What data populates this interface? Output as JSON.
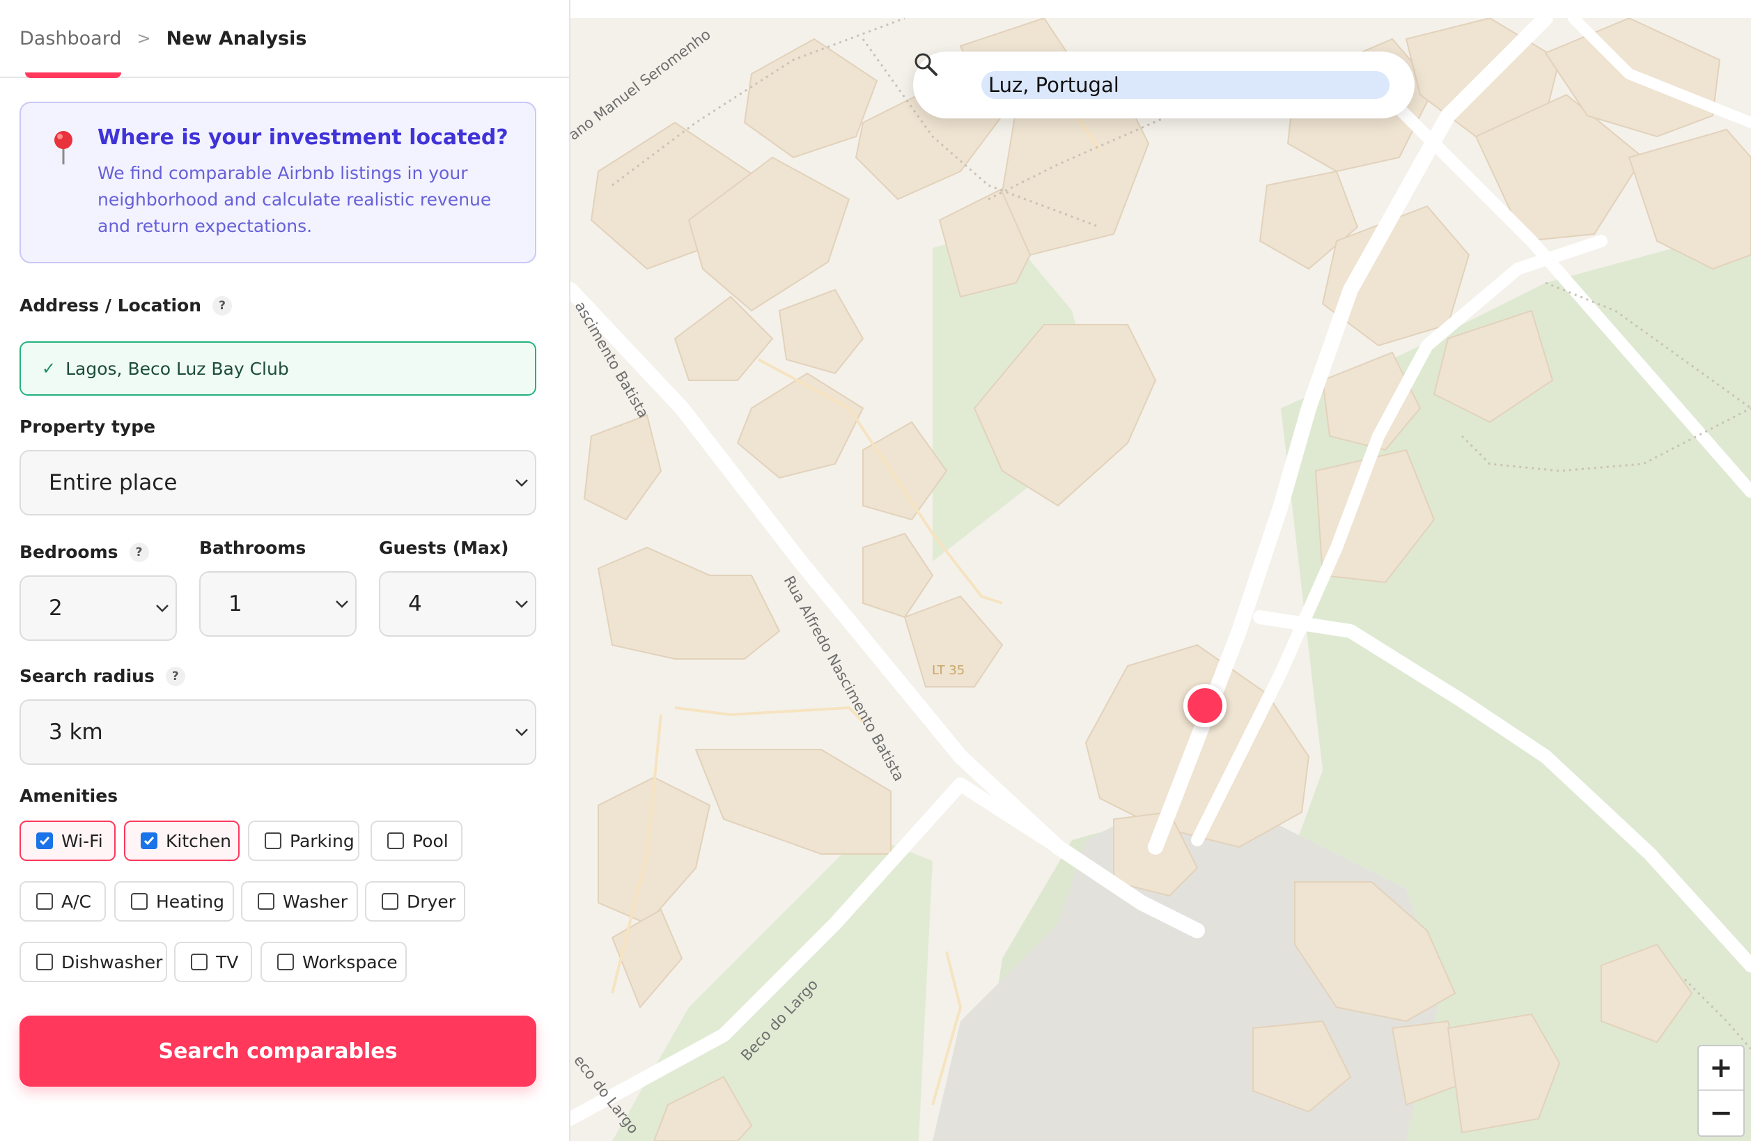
{
  "breadcrumb": {
    "parent": "Dashboard",
    "separator": ">",
    "current": "New Analysis"
  },
  "info": {
    "title": "Where is your investment located?",
    "text": "We find comparable Airbnb listings in your neighborhood and calculate realistic revenue and return expectations.",
    "icon": "map-pin-icon"
  },
  "form": {
    "address_label": "Address / Location",
    "address_value": "Lagos, Beco Luz Bay Club",
    "address_check": "✓",
    "property_type_label": "Property type",
    "property_type_value": "Entire place",
    "bedrooms_label": "Bedrooms",
    "bedrooms_value": "2",
    "bathrooms_label": "Bathrooms",
    "bathrooms_value": "1",
    "guests_label": "Guests (Max)",
    "guests_value": "4",
    "radius_label": "Search radius",
    "radius_value": "3 km",
    "amenities_label": "Amenities",
    "help": "?"
  },
  "amenities": [
    {
      "label": "Wi-Fi",
      "checked": true
    },
    {
      "label": "Kitchen",
      "checked": true
    },
    {
      "label": "Parking",
      "checked": false
    },
    {
      "label": "Pool",
      "checked": false
    },
    {
      "label": "A/C",
      "checked": false
    },
    {
      "label": "Heating",
      "checked": false
    },
    {
      "label": "Washer",
      "checked": false
    },
    {
      "label": "Dryer",
      "checked": false
    },
    {
      "label": "Dishwasher",
      "checked": false
    },
    {
      "label": "TV",
      "checked": false
    },
    {
      "label": "Workspace",
      "checked": false
    }
  ],
  "cta": {
    "label": "Search comparables"
  },
  "map": {
    "search_value": "Luz, Portugal",
    "zoom_in": "+",
    "zoom_out": "−",
    "streets": {
      "manuel_seromenho": "ano Manuel Seromenho",
      "nascimento_batista_top": "ascimento Batista",
      "alfredo_nascimento_batista": "Rua Alfredo Nascimento Batista",
      "beco_do_largo": "Beco do Largo",
      "beco_do_largo_edge": "eco do Largo"
    },
    "lot_label": "LT 35",
    "colors": {
      "land": "#f4f1ea",
      "green": "#dfe9d2",
      "building": "#efe3d1",
      "road": "#ffffff",
      "marker": "#ff385c"
    }
  },
  "colors": {
    "accent": "#ff385c",
    "info_title": "#3f33d8",
    "success": "#23b37d"
  }
}
